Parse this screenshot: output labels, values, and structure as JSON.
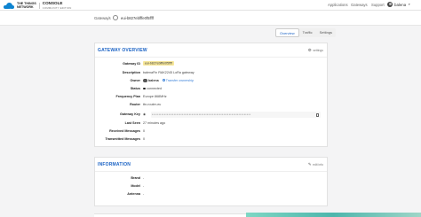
{
  "header": {
    "logo_line1": "THE THINGS",
    "logo_line2": "NETWORK",
    "console_title": "CONSOLE",
    "console_subtitle": "COMMUNITY EDITION",
    "nav": [
      "Applications",
      "Gateways",
      "Support"
    ],
    "user": "balena"
  },
  "breadcrumb": {
    "root": "Gateways",
    "current": "eui-b827ebfffe0f5ffff"
  },
  "tabs": [
    "Overview",
    "Traffic",
    "Settings"
  ],
  "overview": {
    "title": "GATEWAY OVERVIEW",
    "settings_label": "settings",
    "fields": {
      "gateway_id_label": "Gateway ID",
      "gateway_id": "eui-b827ebfffe0f5ffff",
      "description_label": "Description",
      "description": "balenaFin RAK2245 LoRa gateway",
      "owner_label": "Owner",
      "owner": "balena",
      "transfer": "Transfer ownership",
      "status_label": "Status",
      "status": "connected",
      "frequency_label": "Frequency Plan",
      "frequency": "Europe 868MHz",
      "router_label": "Router",
      "router": "ttn-router-eu",
      "key_label": "Gateway Key",
      "key_mask": "••••••••••••••••••••••••••••••••••••••••••••••••••••••••••••••••••••••••",
      "last_seen_label": "Last Seen",
      "last_seen": "27 minutes ago",
      "received_label": "Received Messages",
      "received": "0",
      "transmitted_label": "Transmitted Messages",
      "transmitted": "0"
    }
  },
  "information": {
    "title": "INFORMATION",
    "edit_label": "edit info",
    "brand_label": "Brand",
    "brand": "-",
    "model_label": "Model",
    "model": "-",
    "antenna_label": "Antenna",
    "antenna": "-"
  }
}
